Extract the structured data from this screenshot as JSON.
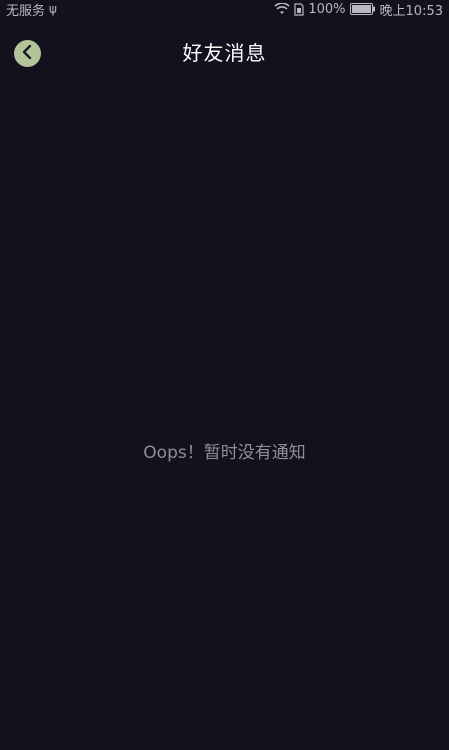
{
  "status_bar": {
    "carrier": "无服务",
    "battery_percent": "100%",
    "time": "晚上10:53",
    "icons": [
      "usb-icon",
      "wifi-icon",
      "sim-icon",
      "battery-icon"
    ]
  },
  "header": {
    "title": "好友消息",
    "back_icon": "chevron-left-icon",
    "back_button_color": "#b3c39a"
  },
  "empty_state": {
    "message": "Oops！暂时没有通知"
  },
  "colors": {
    "background": "#12111d",
    "title": "#ffffff",
    "empty_text": "#8f8e98"
  }
}
